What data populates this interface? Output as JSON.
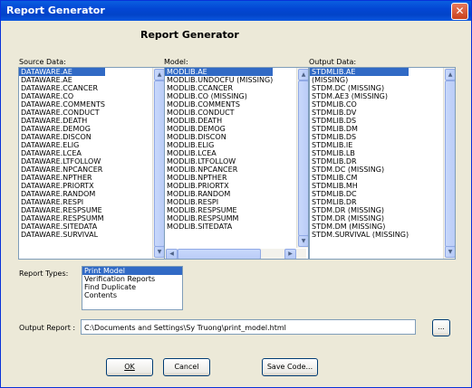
{
  "window": {
    "title": "Report Generator"
  },
  "heading": "Report Generator",
  "source": {
    "label": "Source Data:",
    "selected": 0,
    "items": [
      "DATAWARE.AE",
      "DATAWARE.AE",
      "DATAWARE.CCANCER",
      "DATAWARE.CO",
      "DATAWARE.COMMENTS",
      "DATAWARE.CONDUCT",
      "DATAWARE.DEATH",
      "DATAWARE.DEMOG",
      "DATAWARE.DISCON",
      "DATAWARE.ELIG",
      "DATAWARE.LCEA",
      "DATAWARE.LTFOLLOW",
      "DATAWARE.NPCANCER",
      "DATAWARE.NPTHER",
      "DATAWARE.PRIORTX",
      "DATAWARE.RANDOM",
      "DATAWARE.RESPI",
      "DATAWARE.RESPSUME",
      "DATAWARE.RESPSUMM",
      "DATAWARE.SITEDATA",
      "DATAWARE.SURVIVAL"
    ]
  },
  "model": {
    "label": "Model:",
    "selected": 0,
    "items": [
      "MODLIB.AE",
      "MODLIB.UNDOCFU (MISSING)",
      "MODLIB.CCANCER",
      "MODLIB.CO (MISSING)",
      "MODLIB.COMMENTS",
      "MODLIB.CONDUCT",
      "MODLIB.DEATH",
      "MODLIB.DEMOG",
      "MODLIB.DISCON",
      "MODLIB.ELIG",
      "MODLIB.LCEA",
      "MODLIB.LTFOLLOW",
      "MODLIB.NPCANCER",
      "MODLIB.NPTHER",
      "MODLIB.PRIORTX",
      "MODLIB.RANDOM",
      "MODLIB.RESPI",
      "MODLIB.RESPSUME",
      "MODLIB.RESPSUMM",
      "MODLIB.SITEDATA"
    ]
  },
  "output": {
    "label": "Output Data:",
    "selected": 0,
    "items": [
      "STDMLIB.AE",
      "(MISSING)",
      "STDM.DC (MISSING)",
      "STDM.AE3 (MISSING)",
      "STDMLIB.CO",
      "STDMLIB.DV",
      "STDMLIB.DS",
      "STDMLIB.DM",
      "STDMLIB.DS",
      "STDMLIB.IE",
      "STDMLIB.LB",
      "STDMLIB.DR",
      "STDM.DC (MISSING)",
      "STDMLIB.CM",
      "STDMLIB.MH",
      "STDMLIB.DC",
      "STDMLIB.DR",
      "STDM.DR (MISSING)",
      "STDM.DR (MISSING)",
      "STDM.DM (MISSING)",
      "STDM.SURVIVAL (MISSING)"
    ]
  },
  "report_types": {
    "label": "Report Types:",
    "selected": 0,
    "items": [
      "Print Model",
      "Verification Reports",
      "Find Duplicate",
      "Contents"
    ]
  },
  "output_report": {
    "label": "Output Report :",
    "value": "C:\\Documents and Settings\\Sy Truong\\print_model.html",
    "browse_label": "..."
  },
  "buttons": {
    "ok": "OK",
    "cancel": "Cancel",
    "save_code": "Save Code..."
  },
  "icons": {
    "close": "close-icon",
    "scroll_up": "arrow-up-icon",
    "scroll_down": "arrow-down-icon"
  },
  "colors": {
    "selection": "#316AC5",
    "titlebar": "#0A5FE0",
    "dialog": "#ECE9D8"
  }
}
